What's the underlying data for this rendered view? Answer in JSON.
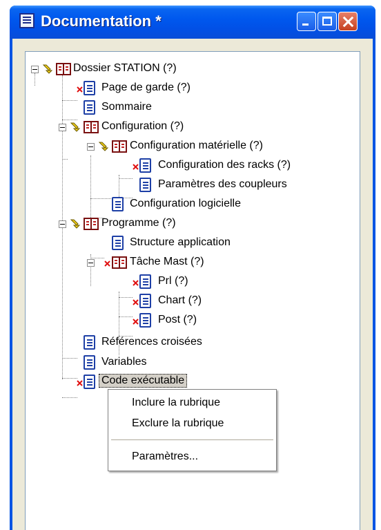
{
  "window": {
    "title": "Documentation *"
  },
  "tree": {
    "root": "Dossier STATION (?)",
    "page_garde": "Page de garde (?)",
    "sommaire": "Sommaire",
    "configuration": "Configuration (?)",
    "config_materielle": "Configuration matérielle (?)",
    "config_racks": "Configuration des racks (?)",
    "param_coupleurs": "Paramètres des coupleurs",
    "config_logicielle": "Configuration logicielle",
    "programme": "Programme (?)",
    "structure_application": "Structure application",
    "tache_mast": "Tâche Mast (?)",
    "prl": "Prl (?)",
    "chart": "Chart (?)",
    "post": "Post (?)",
    "references_croisees": "Références croisées",
    "variables": "Variables",
    "selected_item": "Code exécutable"
  },
  "context_menu": {
    "include": "Inclure la rubrique",
    "exclude": "Exclure la rubrique",
    "parameters": "Paramètres..."
  },
  "colors": {
    "titlebar": "#0058ee",
    "window_bg": "#ece9d8",
    "selection": "#d4d0c8"
  }
}
